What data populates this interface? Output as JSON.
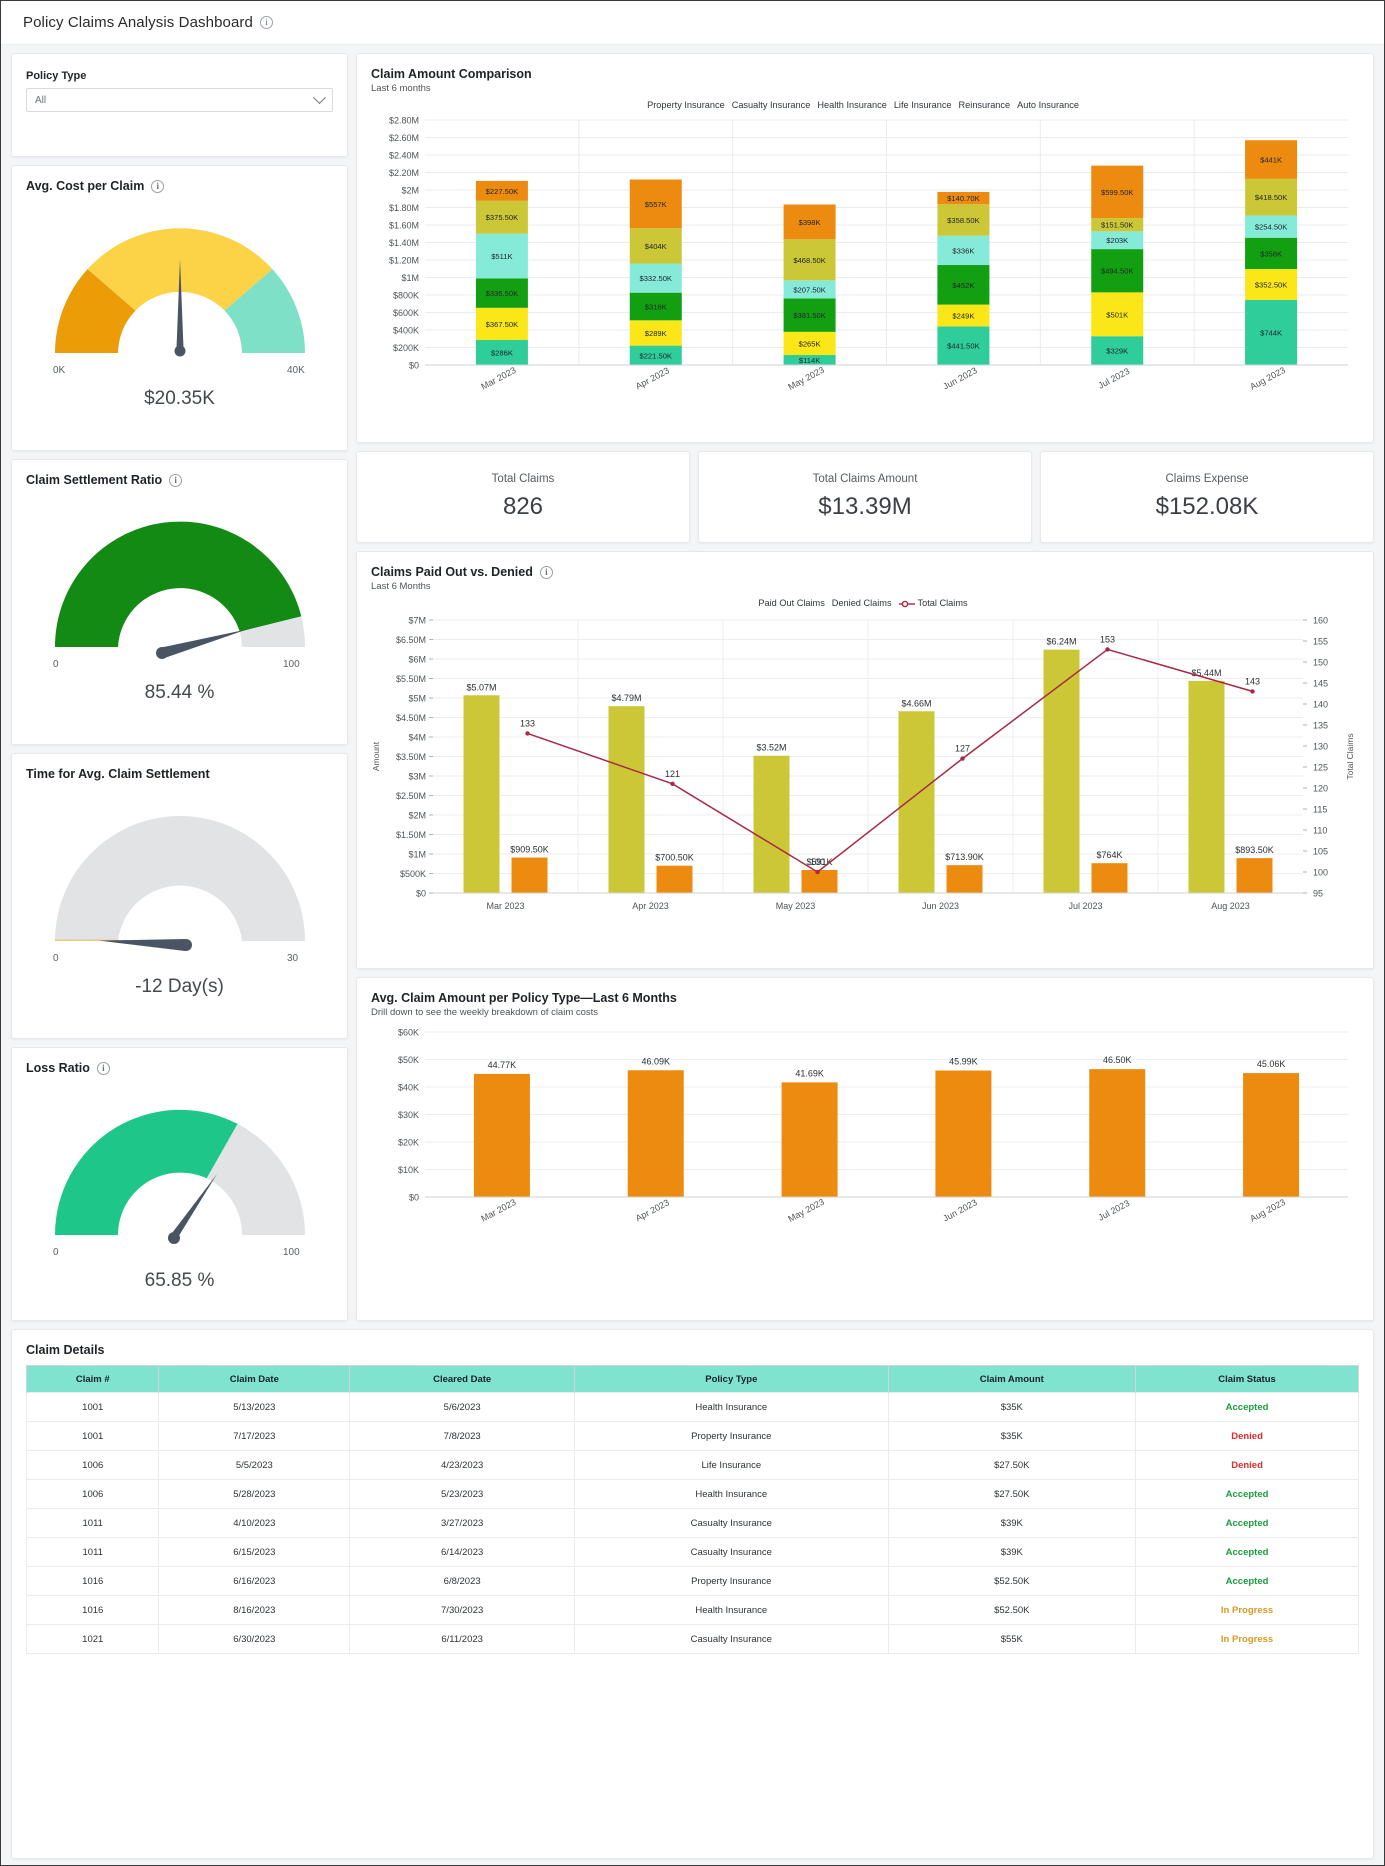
{
  "header": {
    "title": "Policy Claims Analysis Dashboard",
    "info_icon": "info-icon"
  },
  "filter": {
    "label": "Policy Type",
    "value": "All",
    "chevron": "chevron-down-icon"
  },
  "gauges": [
    {
      "title": "Avg. Cost per Claim",
      "value_text": "$20.35K",
      "min_label": "0K",
      "max_label": "40K",
      "min": 0,
      "max": 40,
      "value": 20.35,
      "style": "segmented",
      "segments": [
        {
          "to": 7.2,
          "color": "#eb9c06"
        },
        {
          "to": 28.8,
          "color": "#fcd247"
        },
        {
          "to": 40,
          "color": "#7fe0c8"
        }
      ],
      "has_info": true
    },
    {
      "title": "Claim Settlement Ratio",
      "value_text": "85.44 %",
      "min_label": "0",
      "max_label": "100",
      "min": 0,
      "max": 100,
      "value": 85.44,
      "style": "progress",
      "fill_color": "#128a13",
      "track_color": "#e1e3e4",
      "has_info": true
    },
    {
      "title": "Time for Avg. Claim Settlement",
      "value_text": "-12 Day(s)",
      "min_label": "0",
      "max_label": "30",
      "min": 0,
      "max": 30,
      "value": -12,
      "style": "progress",
      "fill_color": "#e8c77e",
      "track_color": "#e1e3e4",
      "has_info": false
    },
    {
      "title": "Loss Ratio",
      "value_text": "65.85 %",
      "min_label": "0",
      "max_label": "100",
      "min": 0,
      "max": 100,
      "value": 65.85,
      "style": "progress",
      "fill_color": "#1fc68a",
      "track_color": "#e1e3e4",
      "has_info": true
    }
  ],
  "kpis": [
    {
      "label": "Total Claims",
      "value": "826"
    },
    {
      "label": "Total Claims Amount",
      "value": "$13.39M"
    },
    {
      "label": "Claims Expense",
      "value": "$152.08K"
    }
  ],
  "stacked_chart": {
    "title": "Claim Amount Comparison",
    "subtitle": "Last 6 months",
    "info_icon": "info-icon"
  },
  "combo_chart": {
    "title": "Claims Paid Out vs. Denied",
    "subtitle": "Last 6 Months",
    "info_icon": "info-icon"
  },
  "avg_chart": {
    "title": "Avg. Claim Amount per Policy Type—Last 6 Months",
    "subtitle": "Drill down to see the weekly breakdown of claim costs"
  },
  "table": {
    "title": "Claim Details",
    "columns": [
      "Claim #",
      "Claim Date",
      "Cleared Date",
      "Policy Type",
      "Claim Amount",
      "Claim Status"
    ],
    "rows": [
      [
        "1001",
        "5/13/2023",
        "5/6/2023",
        "Health Insurance",
        "$35K",
        "Accepted"
      ],
      [
        "1001",
        "7/17/2023",
        "7/8/2023",
        "Property Insurance",
        "$35K",
        "Denied"
      ],
      [
        "1006",
        "5/5/2023",
        "4/23/2023",
        "Life Insurance",
        "$27.50K",
        "Denied"
      ],
      [
        "1006",
        "5/28/2023",
        "5/23/2023",
        "Health Insurance",
        "$27.50K",
        "Accepted"
      ],
      [
        "1011",
        "4/10/2023",
        "3/27/2023",
        "Casualty Insurance",
        "$39K",
        "Accepted"
      ],
      [
        "1011",
        "6/15/2023",
        "6/14/2023",
        "Casualty Insurance",
        "$39K",
        "Accepted"
      ],
      [
        "1016",
        "6/16/2023",
        "6/8/2023",
        "Property Insurance",
        "$52.50K",
        "Accepted"
      ],
      [
        "1016",
        "8/16/2023",
        "7/30/2023",
        "Health Insurance",
        "$52.50K",
        "In Progress"
      ],
      [
        "1021",
        "6/30/2023",
        "6/11/2023",
        "Casualty Insurance",
        "$55K",
        "In Progress"
      ]
    ]
  },
  "chart_data": [
    {
      "type": "bar",
      "id": "claim-amount-comparison",
      "stacked": true,
      "title": "Claim Amount Comparison",
      "subtitle": "Last 6 months",
      "xlabel": "",
      "ylabel": "",
      "categories": [
        "Mar 2023",
        "Apr 2023",
        "May 2023",
        "Jun 2023",
        "Jul 2023",
        "Aug 2023"
      ],
      "ylim": [
        0,
        2800000
      ],
      "ytick_labels": [
        "$0",
        "$200K",
        "$400K",
        "$600K",
        "$800K",
        "$1M",
        "$1.20M",
        "$1.40M",
        "$1.60M",
        "$1.80M",
        "$2M",
        "$2.20M",
        "$2.40M",
        "$2.60M",
        "$2.80M"
      ],
      "grid": true,
      "legend_position": "top-center",
      "series": [
        {
          "name": "Property Insurance",
          "color": "#2ecd9a",
          "values": [
            286000,
            221500,
            114000,
            441500,
            329000,
            744000
          ],
          "labels": [
            "$286K",
            "$221.50K",
            "$114K",
            "$441.50K",
            "$329K",
            "$744K"
          ]
        },
        {
          "name": "Casualty Insurance",
          "color": "#fbe718",
          "values": [
            367500,
            289000,
            265000,
            249000,
            501000,
            352500
          ],
          "labels": [
            "$367.50K",
            "$289K",
            "$265K",
            "$249K",
            "$501K",
            "$352.50K"
          ]
        },
        {
          "name": "Health Insurance",
          "color": "#12a012",
          "values": [
            336500,
            316000,
            381500,
            452000,
            494500,
            358000
          ],
          "labels": [
            "$336.50K",
            "$316K",
            "$381.50K",
            "$452K",
            "$494.50K",
            "$358K"
          ]
        },
        {
          "name": "Life Insurance",
          "color": "#86ead8",
          "values": [
            511000,
            332500,
            207500,
            336000,
            203000,
            254500
          ],
          "labels": [
            "$511K",
            "$332.50K",
            "$207.50K",
            "$336K",
            "$203K",
            "$254.50K"
          ]
        },
        {
          "name": "Reinsurance",
          "color": "#ccc736",
          "values": [
            375500,
            404000,
            468500,
            358500,
            151500,
            418500
          ],
          "labels": [
            "$375.50K",
            "$404K",
            "$468.50K",
            "$358.50K",
            "$151.50K",
            "$418.50K"
          ]
        },
        {
          "name": "Auto Insurance",
          "color": "#ed8b10",
          "values": [
            227500,
            557000,
            398000,
            140700,
            599500,
            441000
          ],
          "labels": [
            "$227.50K",
            "$557K",
            "$398K",
            "$140.70K",
            "$599.50K",
            "$441K"
          ]
        }
      ]
    },
    {
      "type": "bar",
      "id": "claims-paid-vs-denied",
      "title": "Claims Paid Out vs. Denied",
      "subtitle": "Last 6 Months",
      "xlabel": "",
      "ylabel": "Amount",
      "y2label": "Total Claims",
      "categories": [
        "Mar 2023",
        "Apr 2023",
        "May 2023",
        "Jun 2023",
        "Jul 2023",
        "Aug 2023"
      ],
      "ylim": [
        0,
        7000000
      ],
      "ytick_labels": [
        "$0",
        "$500K",
        "$1M",
        "$1.50M",
        "$2M",
        "$2.50M",
        "$3M",
        "$3.50M",
        "$4M",
        "$4.50M",
        "$5M",
        "$5.50M",
        "$6M",
        "$6.50M",
        "$7M"
      ],
      "y2lim": [
        95,
        160
      ],
      "y2tick_labels": [
        "95",
        "100",
        "105",
        "110",
        "115",
        "120",
        "125",
        "130",
        "135",
        "140",
        "145",
        "150",
        "155",
        "160"
      ],
      "grid": true,
      "legend_position": "top-center",
      "series": [
        {
          "name": "Paid Out Claims",
          "kind": "bar",
          "color": "#ccc736",
          "values": [
            5070000,
            4790000,
            3520000,
            4660000,
            6240000,
            5440000
          ],
          "labels": [
            "$5.07M",
            "$4.79M",
            "$3.52M",
            "$4.66M",
            "$6.24M",
            "$5.44M"
          ]
        },
        {
          "name": "Denied Claims",
          "kind": "bar",
          "color": "#ed8b10",
          "values": [
            909500,
            700500,
            591000,
            713900,
            764000,
            893500
          ],
          "labels": [
            "$909.50K",
            "$700.50K",
            "$591K",
            "$713.90K",
            "$764K",
            "$893.50K"
          ]
        },
        {
          "name": "Total Claims",
          "kind": "line",
          "color": "#a82846",
          "axis": "y2",
          "values": [
            133,
            121,
            100,
            127,
            153,
            143
          ],
          "labels": [
            "133",
            "121",
            "100",
            "127",
            "153",
            "143"
          ]
        }
      ]
    },
    {
      "type": "bar",
      "id": "avg-claim-amount-per-policy-type",
      "title": "Avg. Claim Amount per Policy Type—Last 6 Months",
      "subtitle": "Drill down to see the weekly breakdown of claim costs",
      "xlabel": "",
      "ylabel": "",
      "categories": [
        "Mar 2023",
        "Apr 2023",
        "May 2023",
        "Jun 2023",
        "Jul 2023",
        "Aug 2023"
      ],
      "ylim": [
        0,
        60000
      ],
      "ytick_labels": [
        "$0",
        "$10K",
        "$20K",
        "$30K",
        "$40K",
        "$50K",
        "$60K"
      ],
      "grid": true,
      "color": "#ed8b10",
      "values": [
        44770,
        46090,
        41690,
        45990,
        46500,
        45060
      ],
      "labels": [
        "44.77K",
        "46.09K",
        "41.69K",
        "45.99K",
        "46.50K",
        "45.06K"
      ]
    }
  ]
}
